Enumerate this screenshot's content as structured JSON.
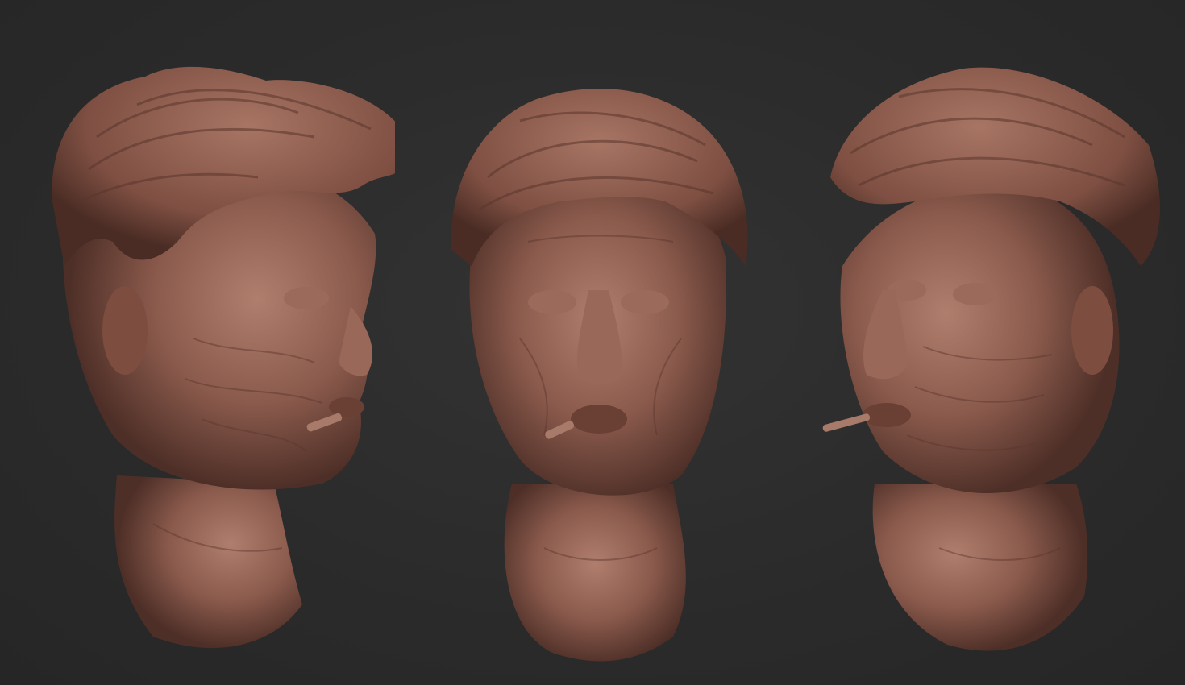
{
  "scene": {
    "background_color": "#2b2b2b",
    "clay_color": "#8a5a4c",
    "clay_highlight": "#b07e6d",
    "clay_shadow": "#4e2f27"
  },
  "views": [
    {
      "view": "three-quarter-right"
    },
    {
      "view": "front"
    },
    {
      "view": "three-quarter-left"
    }
  ]
}
